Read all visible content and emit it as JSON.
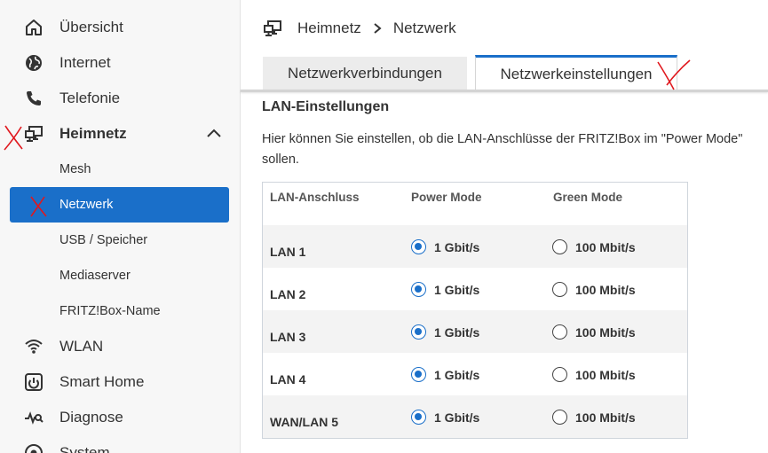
{
  "sidebar": {
    "items": [
      {
        "label": "Übersicht",
        "icon": "home-icon"
      },
      {
        "label": "Internet",
        "icon": "globe-icon"
      },
      {
        "label": "Telefonie",
        "icon": "phone-icon"
      },
      {
        "label": "Heimnetz",
        "icon": "monitor-network-icon",
        "expanded": true
      },
      {
        "label": "WLAN",
        "icon": "wifi-icon"
      },
      {
        "label": "Smart Home",
        "icon": "smart-home-icon"
      },
      {
        "label": "Diagnose",
        "icon": "diagnose-icon"
      },
      {
        "label": "System",
        "icon": "system-icon"
      }
    ],
    "heimnetz_sub": [
      {
        "label": "Mesh"
      },
      {
        "label": "Netzwerk",
        "active": true
      },
      {
        "label": "USB / Speicher"
      },
      {
        "label": "Mediaserver"
      },
      {
        "label": "FRITZ!Box-Name"
      }
    ]
  },
  "breadcrumb": {
    "parent": "Heimnetz",
    "current": "Netzwerk"
  },
  "tabs": [
    {
      "label": "Netzwerkverbindungen",
      "active": false
    },
    {
      "label": "Netzwerkeinstellungen",
      "active": true
    }
  ],
  "section": {
    "title": "LAN-Einstellungen",
    "description_line1": "Hier können Sie einstellen, ob die LAN-Anschlüsse der FRITZ!Box im \"Power Mode\"",
    "description_line2": "sollen."
  },
  "table": {
    "headers": [
      "LAN-Anschluss",
      "Power Mode",
      "Green Mode"
    ],
    "rows": [
      {
        "port": "LAN 1",
        "power": "1 Gbit/s",
        "green": "100 Mbit/s",
        "selected": "power"
      },
      {
        "port": "LAN 2",
        "power": "1 Gbit/s",
        "green": "100 Mbit/s",
        "selected": "power"
      },
      {
        "port": "LAN 3",
        "power": "1 Gbit/s",
        "green": "100 Mbit/s",
        "selected": "power"
      },
      {
        "port": "LAN 4",
        "power": "1 Gbit/s",
        "green": "100 Mbit/s",
        "selected": "power"
      },
      {
        "port": "WAN/LAN 5",
        "power": "1 Gbit/s",
        "green": "100 Mbit/s",
        "selected": "power"
      }
    ]
  },
  "colors": {
    "accent": "#1a6fc9",
    "annotation": "#e0181e"
  }
}
